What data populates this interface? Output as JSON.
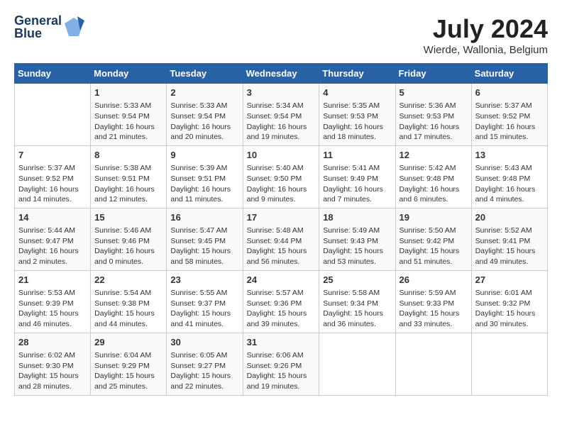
{
  "header": {
    "logo_line1": "General",
    "logo_line2": "Blue",
    "month_year": "July 2024",
    "location": "Wierde, Wallonia, Belgium"
  },
  "days_of_week": [
    "Sunday",
    "Monday",
    "Tuesday",
    "Wednesday",
    "Thursday",
    "Friday",
    "Saturday"
  ],
  "weeks": [
    [
      {
        "day": "",
        "sunrise": "",
        "sunset": "",
        "daylight": ""
      },
      {
        "day": "1",
        "sunrise": "Sunrise: 5:33 AM",
        "sunset": "Sunset: 9:54 PM",
        "daylight": "Daylight: 16 hours and 21 minutes."
      },
      {
        "day": "2",
        "sunrise": "Sunrise: 5:33 AM",
        "sunset": "Sunset: 9:54 PM",
        "daylight": "Daylight: 16 hours and 20 minutes."
      },
      {
        "day": "3",
        "sunrise": "Sunrise: 5:34 AM",
        "sunset": "Sunset: 9:54 PM",
        "daylight": "Daylight: 16 hours and 19 minutes."
      },
      {
        "day": "4",
        "sunrise": "Sunrise: 5:35 AM",
        "sunset": "Sunset: 9:53 PM",
        "daylight": "Daylight: 16 hours and 18 minutes."
      },
      {
        "day": "5",
        "sunrise": "Sunrise: 5:36 AM",
        "sunset": "Sunset: 9:53 PM",
        "daylight": "Daylight: 16 hours and 17 minutes."
      },
      {
        "day": "6",
        "sunrise": "Sunrise: 5:37 AM",
        "sunset": "Sunset: 9:52 PM",
        "daylight": "Daylight: 16 hours and 15 minutes."
      }
    ],
    [
      {
        "day": "7",
        "sunrise": "Sunrise: 5:37 AM",
        "sunset": "Sunset: 9:52 PM",
        "daylight": "Daylight: 16 hours and 14 minutes."
      },
      {
        "day": "8",
        "sunrise": "Sunrise: 5:38 AM",
        "sunset": "Sunset: 9:51 PM",
        "daylight": "Daylight: 16 hours and 12 minutes."
      },
      {
        "day": "9",
        "sunrise": "Sunrise: 5:39 AM",
        "sunset": "Sunset: 9:51 PM",
        "daylight": "Daylight: 16 hours and 11 minutes."
      },
      {
        "day": "10",
        "sunrise": "Sunrise: 5:40 AM",
        "sunset": "Sunset: 9:50 PM",
        "daylight": "Daylight: 16 hours and 9 minutes."
      },
      {
        "day": "11",
        "sunrise": "Sunrise: 5:41 AM",
        "sunset": "Sunset: 9:49 PM",
        "daylight": "Daylight: 16 hours and 7 minutes."
      },
      {
        "day": "12",
        "sunrise": "Sunrise: 5:42 AM",
        "sunset": "Sunset: 9:48 PM",
        "daylight": "Daylight: 16 hours and 6 minutes."
      },
      {
        "day": "13",
        "sunrise": "Sunrise: 5:43 AM",
        "sunset": "Sunset: 9:48 PM",
        "daylight": "Daylight: 16 hours and 4 minutes."
      }
    ],
    [
      {
        "day": "14",
        "sunrise": "Sunrise: 5:44 AM",
        "sunset": "Sunset: 9:47 PM",
        "daylight": "Daylight: 16 hours and 2 minutes."
      },
      {
        "day": "15",
        "sunrise": "Sunrise: 5:46 AM",
        "sunset": "Sunset: 9:46 PM",
        "daylight": "Daylight: 16 hours and 0 minutes."
      },
      {
        "day": "16",
        "sunrise": "Sunrise: 5:47 AM",
        "sunset": "Sunset: 9:45 PM",
        "daylight": "Daylight: 15 hours and 58 minutes."
      },
      {
        "day": "17",
        "sunrise": "Sunrise: 5:48 AM",
        "sunset": "Sunset: 9:44 PM",
        "daylight": "Daylight: 15 hours and 56 minutes."
      },
      {
        "day": "18",
        "sunrise": "Sunrise: 5:49 AM",
        "sunset": "Sunset: 9:43 PM",
        "daylight": "Daylight: 15 hours and 53 minutes."
      },
      {
        "day": "19",
        "sunrise": "Sunrise: 5:50 AM",
        "sunset": "Sunset: 9:42 PM",
        "daylight": "Daylight: 15 hours and 51 minutes."
      },
      {
        "day": "20",
        "sunrise": "Sunrise: 5:52 AM",
        "sunset": "Sunset: 9:41 PM",
        "daylight": "Daylight: 15 hours and 49 minutes."
      }
    ],
    [
      {
        "day": "21",
        "sunrise": "Sunrise: 5:53 AM",
        "sunset": "Sunset: 9:39 PM",
        "daylight": "Daylight: 15 hours and 46 minutes."
      },
      {
        "day": "22",
        "sunrise": "Sunrise: 5:54 AM",
        "sunset": "Sunset: 9:38 PM",
        "daylight": "Daylight: 15 hours and 44 minutes."
      },
      {
        "day": "23",
        "sunrise": "Sunrise: 5:55 AM",
        "sunset": "Sunset: 9:37 PM",
        "daylight": "Daylight: 15 hours and 41 minutes."
      },
      {
        "day": "24",
        "sunrise": "Sunrise: 5:57 AM",
        "sunset": "Sunset: 9:36 PM",
        "daylight": "Daylight: 15 hours and 39 minutes."
      },
      {
        "day": "25",
        "sunrise": "Sunrise: 5:58 AM",
        "sunset": "Sunset: 9:34 PM",
        "daylight": "Daylight: 15 hours and 36 minutes."
      },
      {
        "day": "26",
        "sunrise": "Sunrise: 5:59 AM",
        "sunset": "Sunset: 9:33 PM",
        "daylight": "Daylight: 15 hours and 33 minutes."
      },
      {
        "day": "27",
        "sunrise": "Sunrise: 6:01 AM",
        "sunset": "Sunset: 9:32 PM",
        "daylight": "Daylight: 15 hours and 30 minutes."
      }
    ],
    [
      {
        "day": "28",
        "sunrise": "Sunrise: 6:02 AM",
        "sunset": "Sunset: 9:30 PM",
        "daylight": "Daylight: 15 hours and 28 minutes."
      },
      {
        "day": "29",
        "sunrise": "Sunrise: 6:04 AM",
        "sunset": "Sunset: 9:29 PM",
        "daylight": "Daylight: 15 hours and 25 minutes."
      },
      {
        "day": "30",
        "sunrise": "Sunrise: 6:05 AM",
        "sunset": "Sunset: 9:27 PM",
        "daylight": "Daylight: 15 hours and 22 minutes."
      },
      {
        "day": "31",
        "sunrise": "Sunrise: 6:06 AM",
        "sunset": "Sunset: 9:26 PM",
        "daylight": "Daylight: 15 hours and 19 minutes."
      },
      {
        "day": "",
        "sunrise": "",
        "sunset": "",
        "daylight": ""
      },
      {
        "day": "",
        "sunrise": "",
        "sunset": "",
        "daylight": ""
      },
      {
        "day": "",
        "sunrise": "",
        "sunset": "",
        "daylight": ""
      }
    ]
  ]
}
